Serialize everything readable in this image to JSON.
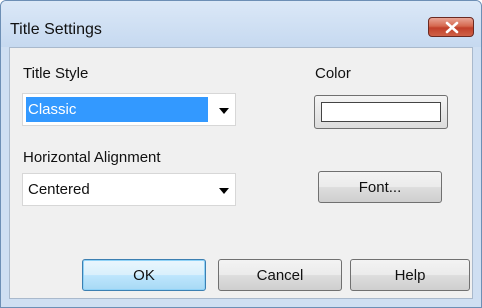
{
  "window": {
    "title": "Title Settings",
    "close_icon": "close-x-icon"
  },
  "title_style": {
    "label": "Title Style",
    "selected": "Classic"
  },
  "horizontal_alignment": {
    "label": "Horizontal Alignment",
    "selected": "Centered"
  },
  "color": {
    "label": "Color",
    "value": "#ffffff"
  },
  "buttons": {
    "font": "Font...",
    "ok": "OK",
    "cancel": "Cancel",
    "help": "Help"
  },
  "colors": {
    "selection": "#3399ff",
    "close_button": "#c7442e",
    "dialog_frame": "#cfdff2",
    "client_bg": "#f0f0f0"
  }
}
